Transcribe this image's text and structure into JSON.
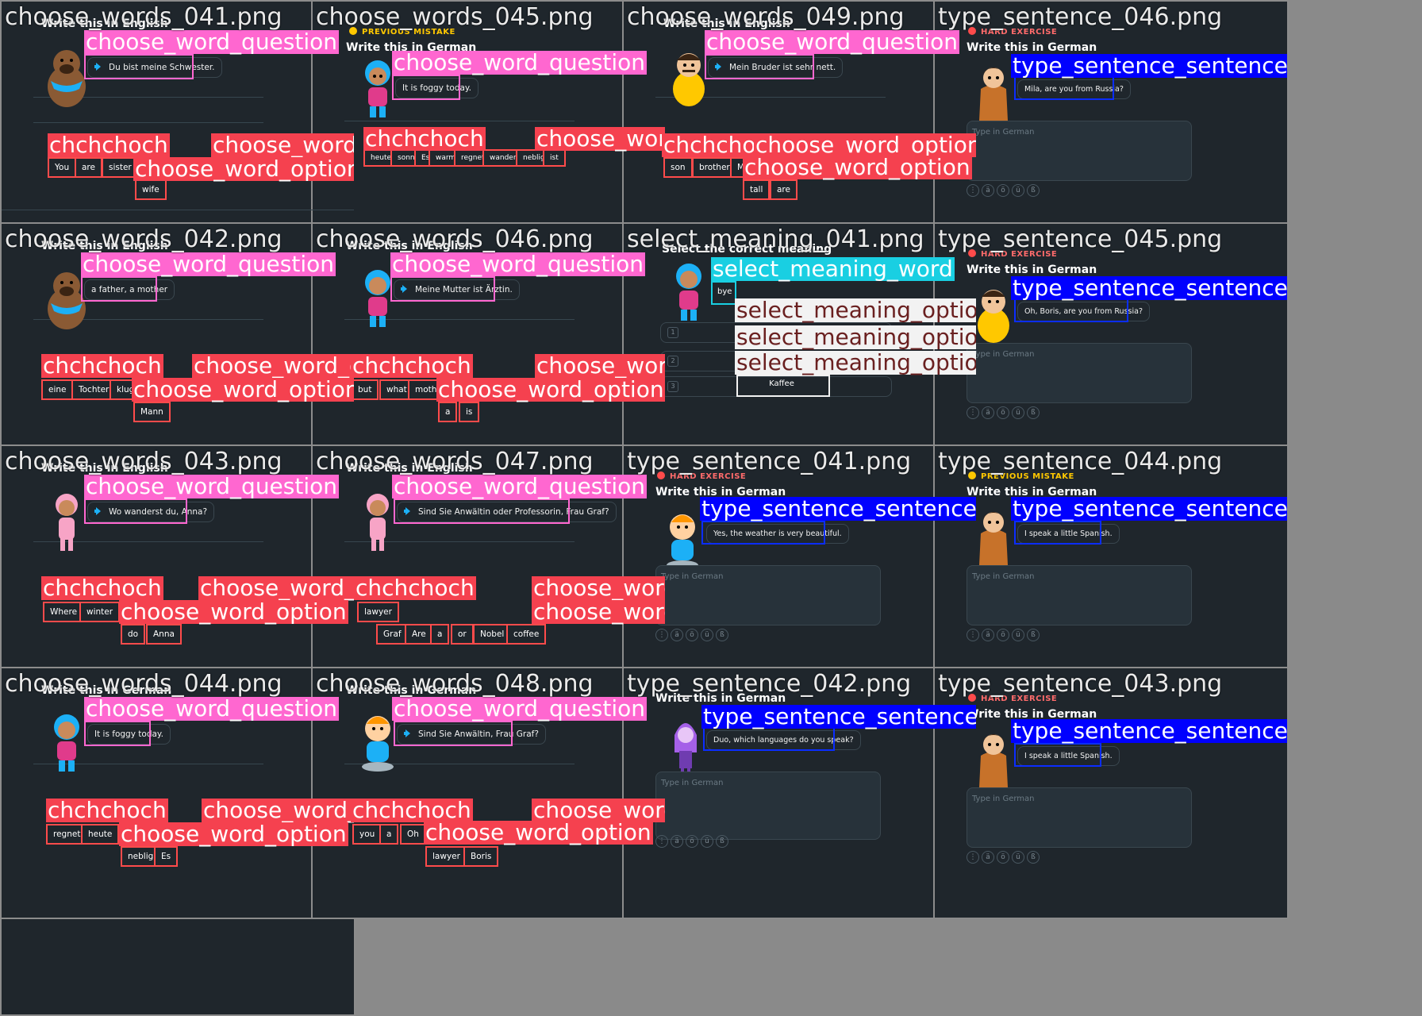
{
  "labels": {
    "choose_word_question": "choose_word_question",
    "choose_word_option": "choose_word_option",
    "type_sentence_sentence": "type_sentence_sentence",
    "select_meaning_word": "select_meaning_word",
    "select_meaning_option": "select_meaning_option",
    "truncated_ch": "chchchoch"
  },
  "ui": {
    "write_english": "Write this in English",
    "write_german": "Write this in German",
    "select_meaning": "Select the correct meaning",
    "hard_exercise": "HARD EXERCISE",
    "previous_mistake": "PREVIOUS MISTAKE",
    "type_placeholder": "Type in German",
    "keys": [
      "ä",
      "ö",
      "ü",
      "ß"
    ]
  },
  "tiles": {
    "t1": {
      "file": "choose_words_041.png",
      "sentence": "Du bist meine Schwester.",
      "words": [
        "You",
        "are",
        "sister",
        "wife"
      ]
    },
    "t2": {
      "file": "choose_words_045.png",
      "sentence": "It is foggy today.",
      "words": [
        "heute",
        "sonnig",
        "Es",
        "warm",
        "regnet",
        "wandern",
        "neblig",
        "ist"
      ]
    },
    "t3": {
      "file": "choose_words_049.png",
      "sentence": "Mein Bruder ist sehr nett.",
      "words": [
        "son",
        "brother",
        "My",
        "tall",
        "are"
      ]
    },
    "t4": {
      "file": "type_sentence_046.png",
      "sentence": "Mila, are you from Russia?"
    },
    "t5": {
      "file": "choose_words_042.png",
      "sentence": "a father, a mother",
      "words": [
        "eine",
        "Tochter",
        "klug",
        "Mann"
      ]
    },
    "t6": {
      "file": "choose_words_046.png",
      "sentence": "Meine Mutter ist Ärztin.",
      "words": [
        "but",
        "what",
        "mother",
        "a",
        "is"
      ]
    },
    "t7": {
      "file": "select_meaning_041.png",
      "word": "bye",
      "option": "Kaffee",
      "nums": [
        "1",
        "2",
        "3"
      ]
    },
    "t8": {
      "file": "type_sentence_045.png",
      "sentence": "Oh, Boris, are you from Russia?"
    },
    "t9": {
      "file": "choose_words_043.png",
      "sentence": "Wo wanderst du, Anna?",
      "words": [
        "Where",
        "winter",
        "do",
        "Anna"
      ]
    },
    "t10": {
      "file": "choose_words_047.png",
      "sentence": "Sind Sie Anwältin oder Professorin, Frau Graf?",
      "words": [
        "lawyer",
        "Graf",
        "Are",
        "a",
        "or",
        "Nobel",
        "coffee"
      ]
    },
    "t11": {
      "file": "type_sentence_041.png",
      "sentence": "Yes, the weather is very beautiful."
    },
    "t12": {
      "file": "type_sentence_044.png",
      "sentence": "I speak a little Spanish."
    },
    "t13": {
      "file": "choose_words_044.png",
      "sentence": "It is foggy today.",
      "words": [
        "regnet",
        "heute",
        "neblig",
        "Es"
      ]
    },
    "t14": {
      "file": "choose_words_048.png",
      "sentence": "Sind Sie Anwältin, Frau Graf?",
      "words": [
        "you",
        "a",
        "Oh",
        "lawyer",
        "Boris"
      ]
    },
    "t15": {
      "file": "type_sentence_042.png",
      "sentence": "Duo, which languages do you speak?"
    },
    "t16": {
      "file": "type_sentence_043.png",
      "sentence": "I speak a little Spanish."
    }
  },
  "colors": {
    "pink": "#ff67d0",
    "red": "#f5414f",
    "blue": "#0000ff",
    "cyan": "#19cfe2",
    "bg": "#1f262c"
  }
}
